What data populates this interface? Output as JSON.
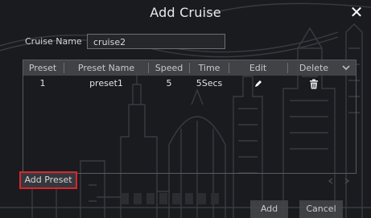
{
  "dialog": {
    "title": "Add Cruise",
    "close_icon": "close-icon"
  },
  "cruise_name": {
    "label": "Cruise Name",
    "value": "cruise2"
  },
  "table": {
    "columns": [
      "Preset",
      "Preset Name",
      "Speed",
      "Time",
      "Edit",
      "Delete"
    ],
    "rows": [
      {
        "preset": "1",
        "preset_name": "preset1",
        "speed": "5",
        "time": "5Secs",
        "edit_icon": "pencil-icon",
        "delete_icon": "trash-icon"
      }
    ]
  },
  "buttons": {
    "add_preset": "Add Preset",
    "add": "Add",
    "cancel": "Cancel"
  },
  "colors": {
    "background": "#1a1b1f",
    "highlight_border": "#d8262b",
    "text": "#e9e9e9"
  }
}
